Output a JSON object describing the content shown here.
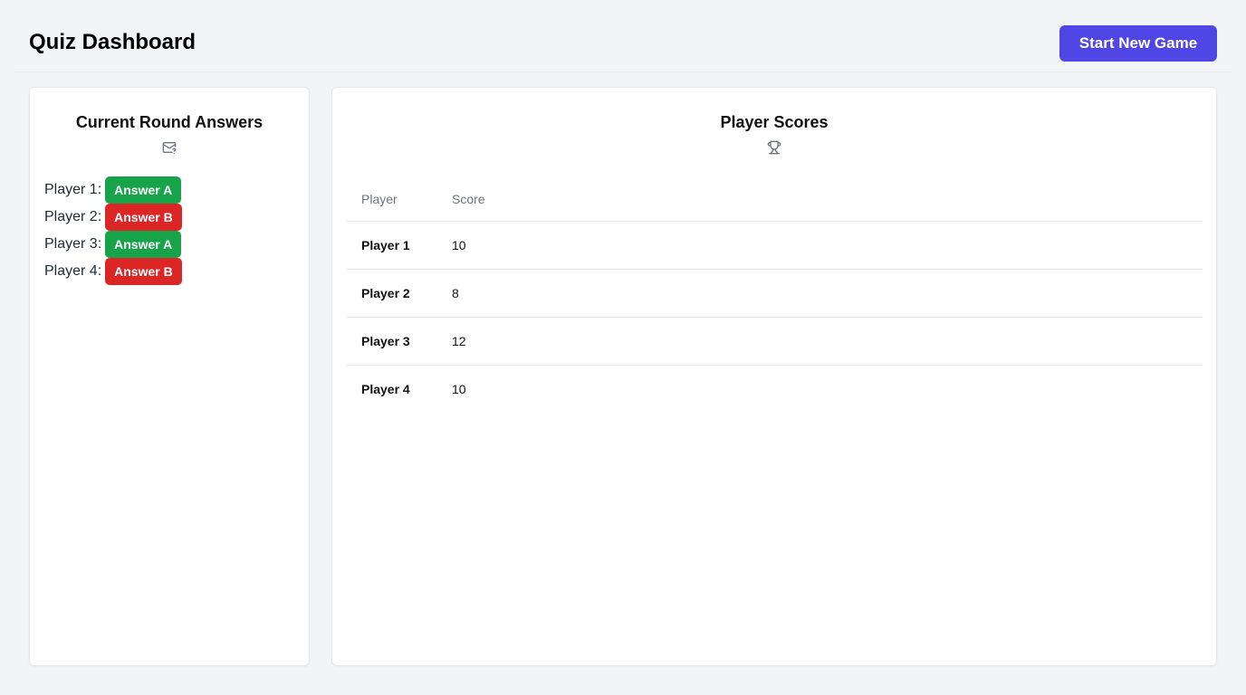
{
  "header": {
    "title": "Quiz Dashboard",
    "new_game_label": "Start New Game"
  },
  "answers_panel": {
    "title": "Current Round Answers",
    "icon": "mail-question-icon",
    "rows": [
      {
        "label": "Player 1:",
        "answer": "Answer A",
        "color": "#16a34a"
      },
      {
        "label": "Player 2:",
        "answer": "Answer B",
        "color": "#dc2626"
      },
      {
        "label": "Player 3:",
        "answer": "Answer A",
        "color": "#16a34a"
      },
      {
        "label": "Player 4:",
        "answer": "Answer B",
        "color": "#dc2626"
      }
    ]
  },
  "scores_panel": {
    "title": "Player Scores",
    "icon": "trophy-icon",
    "columns": [
      "Player",
      "Score"
    ],
    "rows": [
      {
        "player": "Player 1",
        "score": "10"
      },
      {
        "player": "Player 2",
        "score": "8"
      },
      {
        "player": "Player 3",
        "score": "12"
      },
      {
        "player": "Player 4",
        "score": "10"
      }
    ]
  },
  "colors": {
    "accent": "#4f46e5",
    "answer_a": "#16a34a",
    "answer_b": "#dc2626"
  }
}
